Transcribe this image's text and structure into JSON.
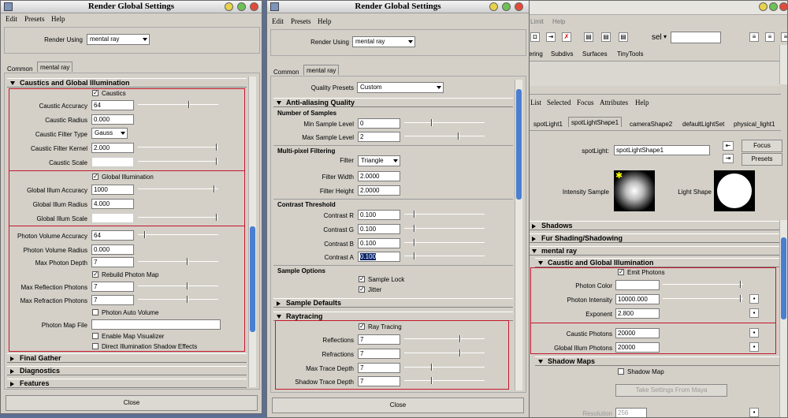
{
  "left": {
    "title": "Render Global Settings",
    "menu": [
      "Edit",
      "Presets",
      "Help"
    ],
    "render_using_label": "Render Using",
    "render_using_value": "mental ray",
    "tabs": [
      "Common",
      "mental ray"
    ],
    "section_open": "Caustics and Global Illumination",
    "caustics_label": "Caustics",
    "caustic_accuracy_label": "Caustic Accuracy",
    "caustic_accuracy": "64",
    "caustic_radius_label": "Caustic Radius",
    "caustic_radius": "0.000",
    "caustic_filter_type_label": "Caustic Filter Type",
    "caustic_filter_type": "Gauss",
    "caustic_filter_kernel_label": "Caustic Filter Kernel",
    "caustic_filter_kernel": "2.000",
    "caustic_scale_label": "Caustic Scale",
    "global_illumination_label": "Global Illumination",
    "gi_accuracy_label": "Global Illum Accuracy",
    "gi_accuracy": "1000",
    "gi_radius_label": "Global Illum Radius",
    "gi_radius": "4.000",
    "gi_scale_label": "Global Illum Scale",
    "photon_volume_accuracy_label": "Photon Volume Accuracy",
    "photon_volume_accuracy": "64",
    "photon_volume_radius_label": "Photon Volume Radius",
    "photon_volume_radius": "0.000",
    "max_photon_depth_label": "Max Photon Depth",
    "max_photon_depth": "7",
    "rebuild_photon_map_label": "Rebuild Photon Map",
    "max_reflection_photons_label": "Max Reflection Photons",
    "max_reflection_photons": "7",
    "max_refraction_photons_label": "Max Refraction Photons",
    "max_refraction_photons": "7",
    "photon_auto_volume_label": "Photon Auto Volume",
    "photon_map_file_label": "Photon Map File",
    "enable_map_visualizer_label": "Enable Map Visualizer",
    "direct_illum_shadow_label": "Direct Illumination Shadow Effects",
    "final_gather": "Final Gather",
    "diagnostics": "Diagnostics",
    "features": "Features",
    "close": "Close"
  },
  "middle": {
    "title": "Render Global Settings",
    "menu": [
      "Edit",
      "Presets",
      "Help"
    ],
    "render_using_label": "Render Using",
    "render_using_value": "mental ray",
    "tabs": [
      "Common",
      "mental ray"
    ],
    "quality_presets_label": "Quality Presets",
    "quality_presets": "Custom",
    "aa_quality": "Anti-aliasing Quality",
    "number_of_samples": "Number of Samples",
    "min_sample_level_label": "Min Sample Level",
    "min_sample_level": "0",
    "max_sample_level_label": "Max Sample Level",
    "max_sample_level": "2",
    "multipixel_filtering": "Multi-pixel Filtering",
    "filter_label": "Filter",
    "filter": "Triangle",
    "filter_width_label": "Filter Width",
    "filter_width": "2.0000",
    "filter_height_label": "Filter Height",
    "filter_height": "2.0000",
    "contrast_threshold": "Contrast Threshold",
    "contrast_r_label": "Contrast R",
    "contrast_r": "0.100",
    "contrast_g_label": "Contrast G",
    "contrast_g": "0.100",
    "contrast_b_label": "Contrast B",
    "contrast_b": "0.100",
    "contrast_a_label": "Contrast A",
    "contrast_a": "0.100",
    "sample_options": "Sample Options",
    "sample_lock_label": "Sample Lock",
    "jitter_label": "Jitter",
    "sample_defaults": "Sample Defaults",
    "raytracing": "Raytracing",
    "ray_tracing_label": "Ray Tracing",
    "reflections_label": "Reflections",
    "reflections": "7",
    "refractions_label": "Refractions",
    "refractions": "7",
    "max_trace_depth_label": "Max Trace Depth",
    "max_trace_depth": "7",
    "shadow_trace_depth_label": "Shadow Trace Depth",
    "shadow_trace_depth": "7",
    "close": "Close"
  },
  "right": {
    "menu_top": [
      "Limit",
      "Help"
    ],
    "select_field": "sel",
    "shelf_tabs": [
      "ering",
      "Subdivs",
      "Surfaces",
      "TinyTools"
    ],
    "menu2": [
      "List",
      "Selected",
      "Focus",
      "Attributes",
      "Help"
    ],
    "node_tabs": [
      "spotLight1",
      "spotLightShape1",
      "cameraShape2",
      "defaultLightSet",
      "physical_light1"
    ],
    "spotlight_label": "spotLight:",
    "spotlight_value": "spotLightShape1",
    "focus": "Focus",
    "presets": "Presets",
    "intensity_sample": "Intensity Sample",
    "light_shape": "Light Shape",
    "shadows": "Shadows",
    "fur_shading": "Fur Shading/Shadowing",
    "mental_ray": "mental ray",
    "caustic_gi": "Caustic and Global Illumination",
    "emit_photons_label": "Emit Photons",
    "photon_color_label": "Photon Color",
    "photon_intensity_label": "Photon Intensity",
    "photon_intensity": "10000.000",
    "exponent_label": "Exponent",
    "exponent": "2.800",
    "caustic_photons_label": "Caustic Photons",
    "caustic_photons": "20000",
    "gi_photons_label": "Global Illum Photons",
    "gi_photons": "20000",
    "shadow_maps": "Shadow Maps",
    "shadow_map_label": "Shadow Map",
    "take_settings": "Take Settings From Maya",
    "resolution_label": "Resolution",
    "resolution": "256"
  }
}
